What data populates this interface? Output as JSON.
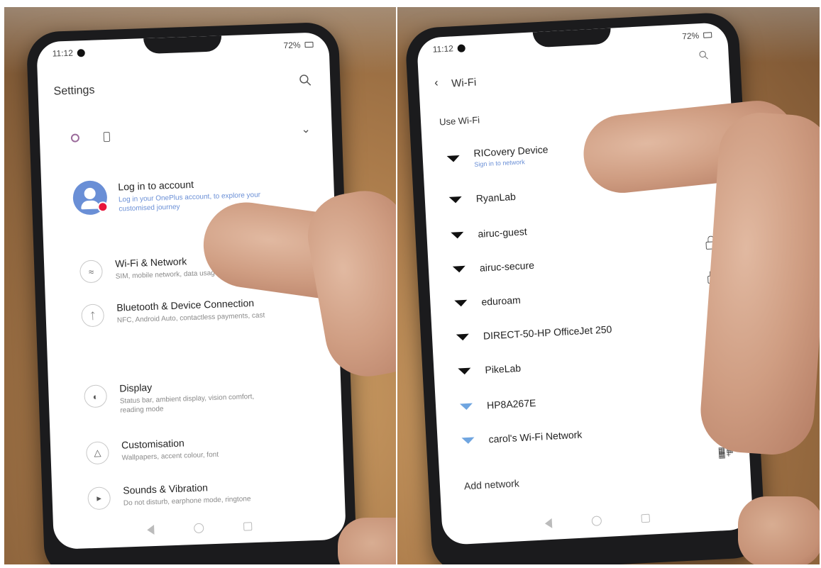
{
  "left_phone": {
    "status_time": "11:12",
    "battery": "72%",
    "title": "Settings",
    "account": {
      "title": "Log in to account",
      "subtitle": "Log in your OnePlus account, to explore your customised journey"
    },
    "items": [
      {
        "title": "Wi-Fi & Network",
        "subtitle": "SIM, mobile network, data usage, hotspot",
        "icon": "wifi-icon"
      },
      {
        "title": "Bluetooth & Device Connection",
        "subtitle": "NFC, Android Auto, contactless payments, cast",
        "icon": "bluetooth-icon"
      },
      {
        "title": "Display",
        "subtitle": "Status bar, ambient display, vision comfort, reading mode",
        "icon": "display-icon"
      },
      {
        "title": "Customisation",
        "subtitle": "Wallpapers, accent colour, font",
        "icon": "shirt-icon"
      },
      {
        "title": "Sounds & Vibration",
        "subtitle": "Do not disturb, earphone mode, ringtone",
        "icon": "speaker-icon"
      }
    ]
  },
  "right_phone": {
    "status_time": "11:12",
    "battery": "72%",
    "title": "Wi-Fi",
    "use_wifi": "Use Wi-Fi",
    "networks": [
      {
        "name": "RICovery Device",
        "subtitle": "Sign in to network",
        "locked": false,
        "signal": "strong"
      },
      {
        "name": "RyanLab",
        "subtitle": "",
        "locked": true,
        "signal": "strong"
      },
      {
        "name": "airuc-guest",
        "subtitle": "",
        "locked": false,
        "signal": "strong"
      },
      {
        "name": "airuc-secure",
        "subtitle": "",
        "locked": true,
        "signal": "strong"
      },
      {
        "name": "eduroam",
        "subtitle": "",
        "locked": true,
        "signal": "strong"
      },
      {
        "name": "DIRECT-50-HP OfficeJet 250",
        "subtitle": "",
        "locked": true,
        "signal": "strong"
      },
      {
        "name": "PikeLab",
        "subtitle": "",
        "locked": true,
        "signal": "strong"
      },
      {
        "name": "HP8A267E",
        "subtitle": "",
        "locked": false,
        "signal": "weak"
      },
      {
        "name": "carol's Wi-Fi Network",
        "subtitle": "",
        "locked": true,
        "signal": "weak"
      }
    ],
    "add_network": "Add network"
  },
  "colors": {
    "accent": "#6a8fd6",
    "badge": "#e8163b",
    "phone_frame": "#1b1b1d",
    "table": "#a97a4a"
  }
}
